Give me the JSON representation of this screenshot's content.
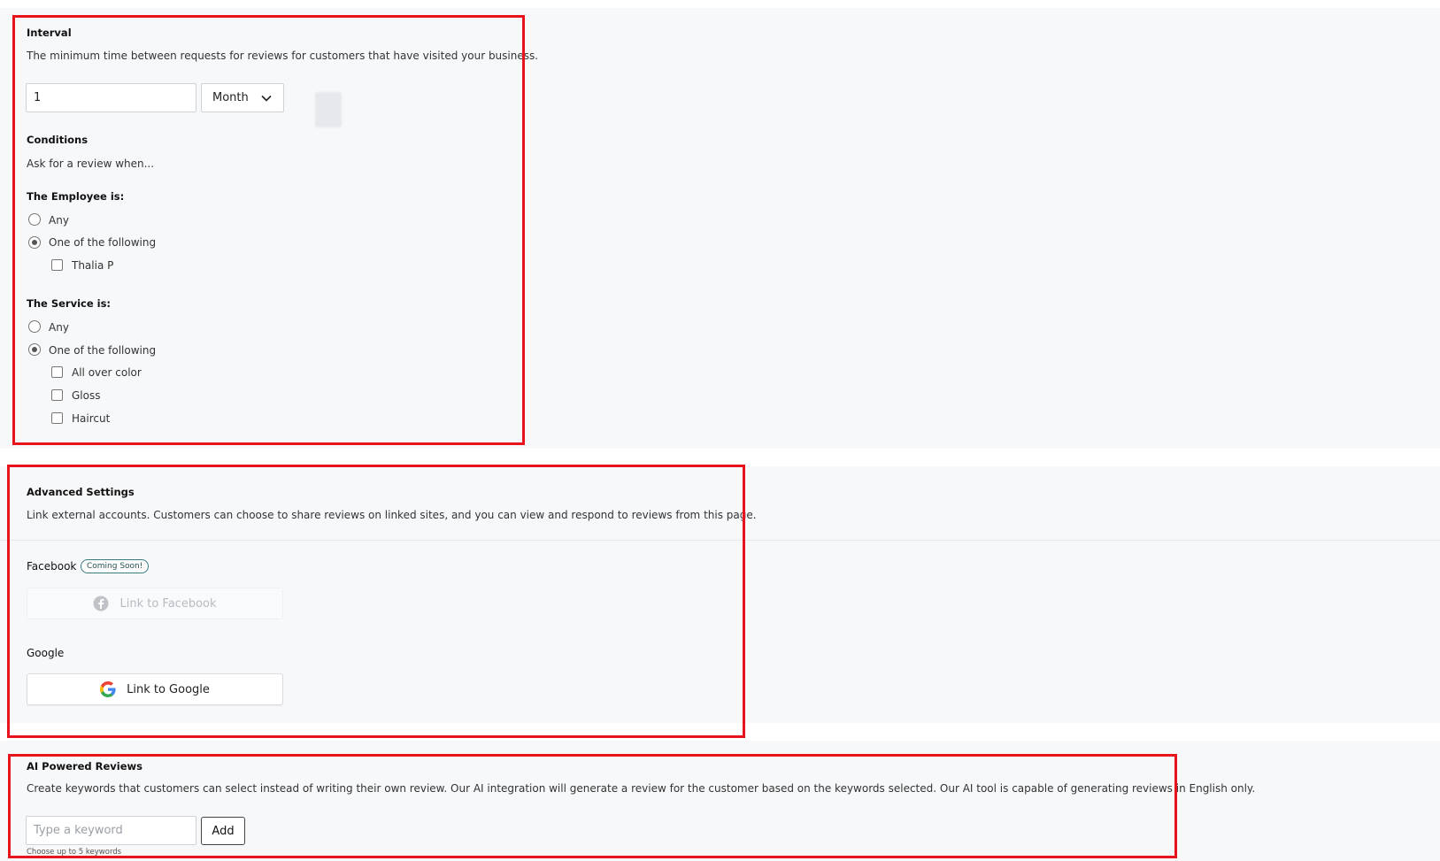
{
  "interval": {
    "title": "Interval",
    "description": "The minimum time between requests for reviews for customers that have visited your business.",
    "value": "1",
    "unit": "Month"
  },
  "conditions": {
    "title": "Conditions",
    "subtitle": "Ask for a review when...",
    "employee": {
      "title": "The Employee is:",
      "options": [
        "Any",
        "One of the following"
      ],
      "selected": "One of the following",
      "items": [
        {
          "label": "Thalia P",
          "checked": false
        }
      ]
    },
    "service": {
      "title": "The Service is:",
      "options": [
        "Any",
        "One of the following"
      ],
      "selected": "One of the following",
      "items": [
        {
          "label": "All over color",
          "checked": false
        },
        {
          "label": "Gloss",
          "checked": false
        },
        {
          "label": "Haircut",
          "checked": false
        }
      ]
    }
  },
  "advanced": {
    "title": "Advanced Settings",
    "description": "Link external accounts. Customers can choose to share reviews on linked sites, and you can view and respond to reviews from this page.",
    "facebook": {
      "label": "Facebook",
      "badge": "Coming Soon!",
      "button": "Link to Facebook"
    },
    "google": {
      "label": "Google",
      "button": "Link to Google"
    }
  },
  "ai": {
    "title": "AI Powered Reviews",
    "description": "Create keywords that customers can select instead of writing their own review. Our AI integration will generate a review for the customer based on the keywords selected. Our AI tool is capable of generating reviews in English only.",
    "input_placeholder": "Type a keyword",
    "add_label": "Add",
    "hint": "Choose up to 5 keywords"
  },
  "colors": {
    "highlight": "#e8141d",
    "panel": "#f7f8fa",
    "badge_border": "#3a7d7d"
  }
}
